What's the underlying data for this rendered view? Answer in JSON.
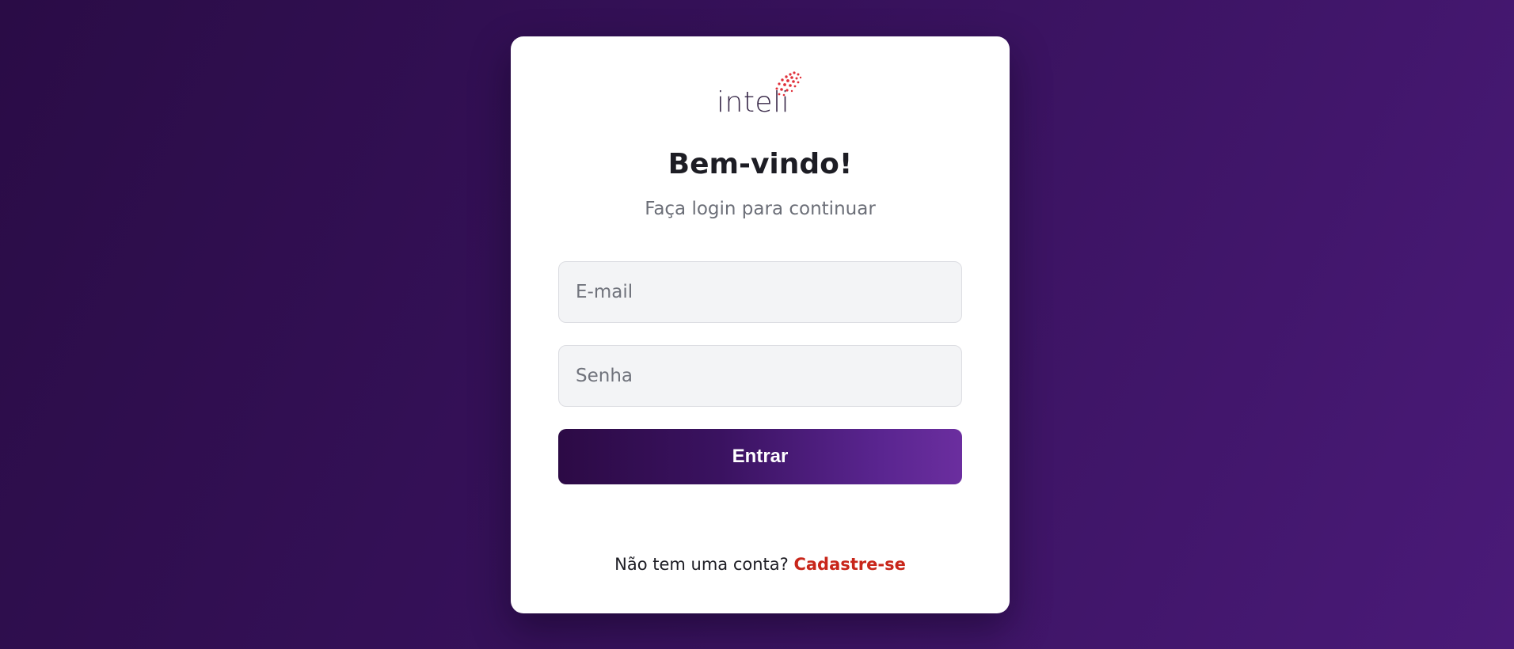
{
  "brand": {
    "logo_text": "inteli",
    "accent_color": "#e0303a"
  },
  "login": {
    "title": "Bem-vindo!",
    "subtitle": "Faça login para continuar",
    "email_placeholder": "E-mail",
    "email_value": "",
    "password_placeholder": "Senha",
    "password_value": "",
    "submit_label": "Entrar"
  },
  "footer": {
    "prompt": "Não tem uma conta?",
    "signup_label": "Cadastre-se"
  },
  "colors": {
    "background_start": "#2a0c46",
    "background_end": "#4a1a78",
    "button_start": "#2c0a45",
    "button_end": "#6b2e9f",
    "link": "#c8261a"
  }
}
